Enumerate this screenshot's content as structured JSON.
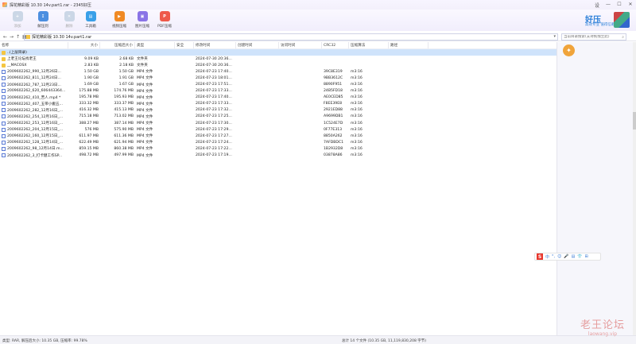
{
  "window": {
    "title": "探花精彩版 10.30 14v.part1.rar - 2345好压",
    "controls": [
      "设置",
      "—",
      "☐",
      "✕"
    ]
  },
  "toolbar": {
    "buttons": [
      {
        "label": "添加",
        "dim": true,
        "color": "#cbd7e6",
        "icon": "+"
      },
      {
        "label": "解压到",
        "dim": false,
        "color": "#4c8fe0",
        "icon": "↧"
      },
      {
        "label": "删除",
        "dim": true,
        "color": "#cbd7e6",
        "icon": "✕"
      },
      {
        "label": "工具箱",
        "dim": false,
        "color": "#3aa0e8",
        "icon": "▤"
      },
      {
        "label": "视频压缩",
        "dim": false,
        "color": "#f08a24",
        "icon": "▶"
      },
      {
        "label": "图片压缩",
        "dim": false,
        "color": "#8a74e6",
        "icon": "▣"
      },
      {
        "label": "PDF压缩",
        "dim": false,
        "color": "#ee5a4a",
        "icon": "P"
      }
    ]
  },
  "brand": {
    "logo": "好压",
    "tagline": "高效专业 值得信赖"
  },
  "addressbar": {
    "nav": [
      "←",
      "→",
      "↑",
      "▦"
    ],
    "path": "探花精彩版 10.30 14v.part1.rar",
    "search_placeholder": "当前目录搜索(支持拖拽至此)"
  },
  "table": {
    "columns": [
      "名称",
      "大小",
      "压缩后大小",
      "类型",
      "安全",
      "修改时间",
      "创建时间",
      "访问时间",
      "CRC32",
      "压缩算法",
      "路径"
    ],
    "rows": [
      {
        "name": "..(上层目录)",
        "icon": "folder",
        "size": "",
        "packed": "",
        "type": "",
        "mtime": "",
        "crc": "",
        "method": "",
        "selected": true
      },
      {
        "name": "上老王论坛找老王",
        "icon": "folder",
        "size": "9.09 KB",
        "packed": "2.68 KB",
        "type": "文件夹",
        "mtime": "2024-07-30 20:36...",
        "crc": "",
        "method": "",
        "selected": false
      },
      {
        "name": "__MACOSX",
        "icon": "folder",
        "size": "2.83 KB",
        "packed": "2.18 KB",
        "type": "文件夹",
        "mtime": "2024-07-30 20:36...",
        "crc": "",
        "method": "",
        "selected": false
      },
      {
        "name": "2009602262_990_12月26日...",
        "icon": "mp4",
        "size": "1.50 GB",
        "packed": "1.50 GB",
        "type": "MP4 文件",
        "mtime": "2024-07-23 17:40...",
        "crc": "39C8E319",
        "method": "m3:16",
        "selected": false
      },
      {
        "name": "2009602262_811_12月24日...",
        "icon": "mp4",
        "size": "1.90 GB",
        "packed": "1.91 GB",
        "type": "MP4 文件",
        "mtime": "2024-07-23 18:01...",
        "crc": "9BB3612C",
        "method": "m3:16",
        "selected": false
      },
      {
        "name": "2009602262_787_12月23日...",
        "icon": "mp4",
        "size": "1.69 GB",
        "packed": "1.67 GB",
        "type": "MP4 文件",
        "mtime": "2024-07-23 17:51...",
        "crc": "8890F951",
        "method": "m3:16",
        "selected": false
      },
      {
        "name": "2009602262_620_606443364...",
        "icon": "mp4",
        "size": "175.88 MB",
        "packed": "174.76 MB",
        "type": "MP4 文件",
        "mtime": "2024-07-23 17:33...",
        "crc": "24B5FD18",
        "method": "m3:16",
        "selected": false
      },
      {
        "name": "2009602262_410_苦人.mp4 *",
        "icon": "mp4",
        "size": "195.78 MB",
        "packed": "195.93 MB",
        "type": "MP4 文件",
        "mtime": "2024-07-23 17:40...",
        "crc": "AE0CED85",
        "method": "m3:16",
        "selected": false
      },
      {
        "name": "2009602262_407_五带小搬五...",
        "icon": "mp4",
        "size": "333.32 MB",
        "packed": "333.37 MB",
        "type": "MP4 文件",
        "mtime": "2024-07-23 17:33...",
        "crc": "F8EE39E8",
        "method": "m3:16",
        "selected": false
      },
      {
        "name": "2009602262_282_12月16日_...",
        "icon": "mp4",
        "size": "416.32 MB",
        "packed": "415.13 MB",
        "type": "MP4 文件",
        "mtime": "2024-07-23 17:32...",
        "crc": "2921ED88",
        "method": "m3:16",
        "selected": false
      },
      {
        "name": "2009602262_254_12月16日_...",
        "icon": "mp4",
        "size": "715.18 MB",
        "packed": "713.02 MB",
        "type": "MP4 文件",
        "mtime": "2024-07-23 17:25...",
        "crc": "A9699DB1",
        "method": "m3:16",
        "selected": false
      },
      {
        "name": "2009602262_253_12月16日_...",
        "icon": "mp4",
        "size": "388.27 MB",
        "packed": "387.14 MB",
        "type": "MP4 文件",
        "mtime": "2024-07-23 17:30...",
        "crc": "1C524E7D",
        "method": "m3:16",
        "selected": false
      },
      {
        "name": "2009602262_204_12月15日_...",
        "icon": "mp4",
        "size": "576 MB",
        "packed": "575.90 MB",
        "type": "MP4 文件",
        "mtime": "2024-07-23 17:29...",
        "crc": "0F77E313",
        "method": "m3:16",
        "selected": false
      },
      {
        "name": "2009602262_160_12月15日_...",
        "icon": "mp4",
        "size": "611.97 MB",
        "packed": "611.36 MB",
        "type": "MP4 文件",
        "mtime": "2024-07-23 17:27...",
        "crc": "8850A262",
        "method": "m3:16",
        "selected": false
      },
      {
        "name": "2009602262_128_12月14日_...",
        "icon": "mp4",
        "size": "622.49 MB",
        "packed": "621.94 MB",
        "type": "MP4 文件",
        "mtime": "2024-07-23 17:24...",
        "crc": "7AFDBDC1",
        "method": "m3:16",
        "selected": false
      },
      {
        "name": "2009602262_98_12月14日.m...",
        "icon": "mp4",
        "size": "859.15 MB",
        "packed": "860.38 MB",
        "type": "MP4 文件",
        "mtime": "2024-07-23 17:22...",
        "crc": "1B2932D8",
        "method": "m3:16",
        "selected": false
      },
      {
        "name": "2009602262_3_打卡健工作SP...",
        "icon": "mp4",
        "size": "498.72 MB",
        "packed": "497.99 MB",
        "type": "MP4 文件",
        "mtime": "2024-07-23 17:19...",
        "crc": "03878A86",
        "method": "m3:16",
        "selected": false
      }
    ]
  },
  "ime": {
    "label": "S",
    "items": [
      "中",
      "°,",
      "☺",
      "🎤",
      "▤",
      "👕",
      "⊞"
    ]
  },
  "status": {
    "left": "类型: RAR, 解压后大小: 10.35 GB, 压缩率: 99.78%",
    "right": "总计 14 个文件 (10.35 GB, 11,119,830,208 字节)"
  },
  "watermark": {
    "line1": "老王论坛",
    "line2": "laowang.vip"
  }
}
